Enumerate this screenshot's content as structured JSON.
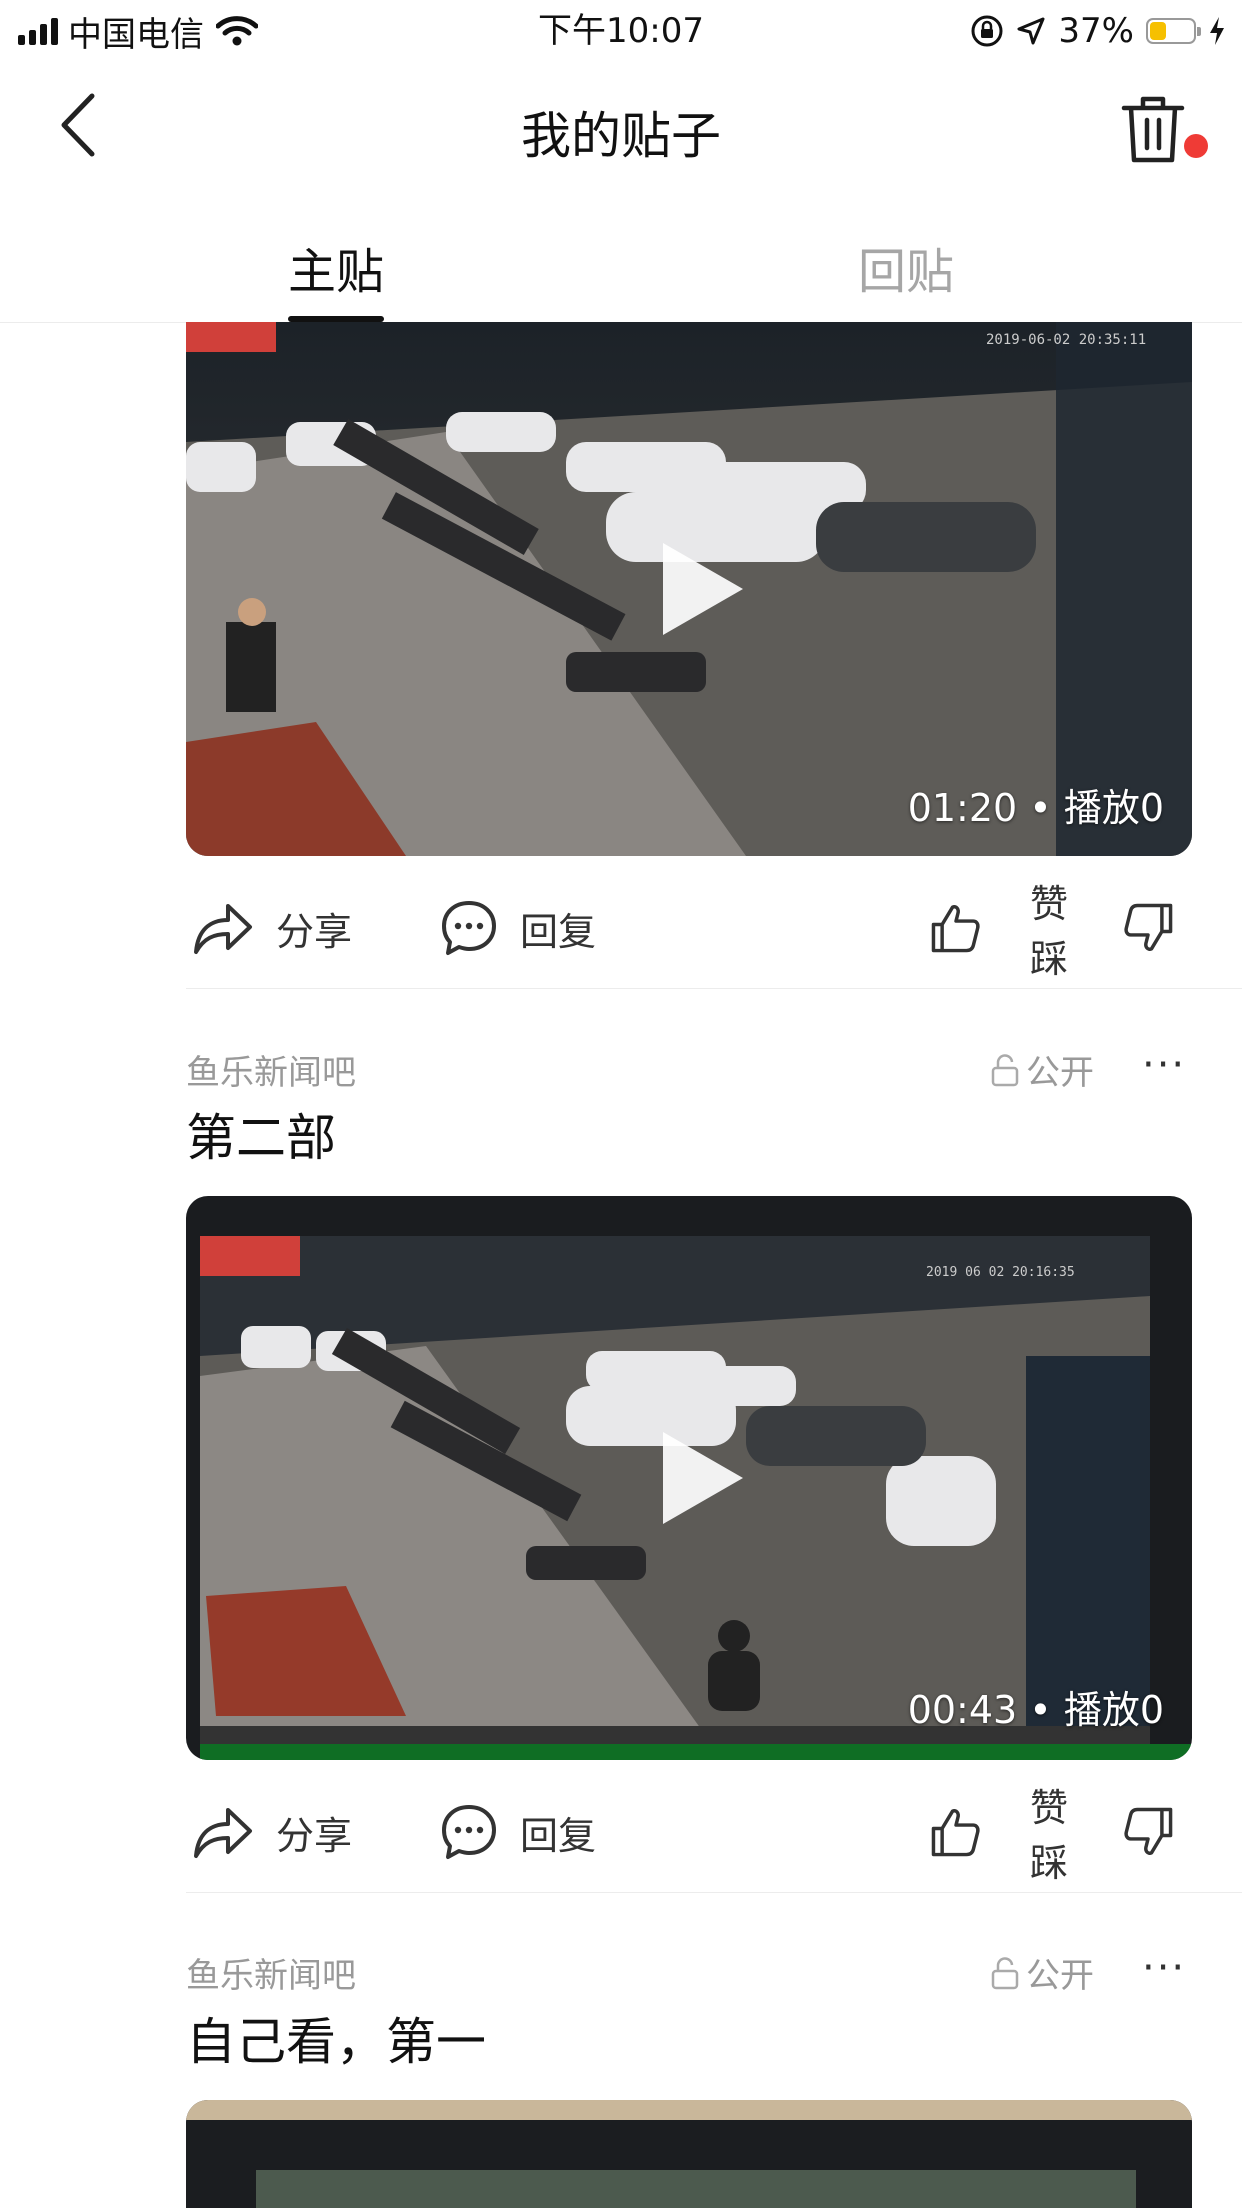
{
  "status_bar": {
    "carrier": "中国电信",
    "time": "下午10:07",
    "battery_percent": "37%",
    "battery_level": 0.37,
    "battery_color": "#f6c000"
  },
  "nav": {
    "title": "我的贴子",
    "notification_dot_color": "#ef3b36",
    "icons": {
      "back": "chevron-left-icon",
      "delete": "trash-icon"
    }
  },
  "tabs": [
    {
      "label": "主贴",
      "active": true
    },
    {
      "label": "回贴",
      "active": false
    }
  ],
  "posts": [
    {
      "video": {
        "duration": "01:20",
        "separator": "•",
        "plays": "播放0"
      },
      "actions": {
        "share": "分享",
        "reply": "回复",
        "vote": "赞踩"
      }
    },
    {
      "forum": "鱼乐新闻吧",
      "privacy": "公开",
      "more": "···",
      "title": "第二部",
      "video": {
        "duration": "00:43",
        "separator": "•",
        "plays": "播放0"
      },
      "actions": {
        "share": "分享",
        "reply": "回复",
        "vote": "赞踩"
      }
    },
    {
      "forum": "鱼乐新闻吧",
      "privacy": "公开",
      "more": "···",
      "title": "自己看，第一"
    }
  ]
}
